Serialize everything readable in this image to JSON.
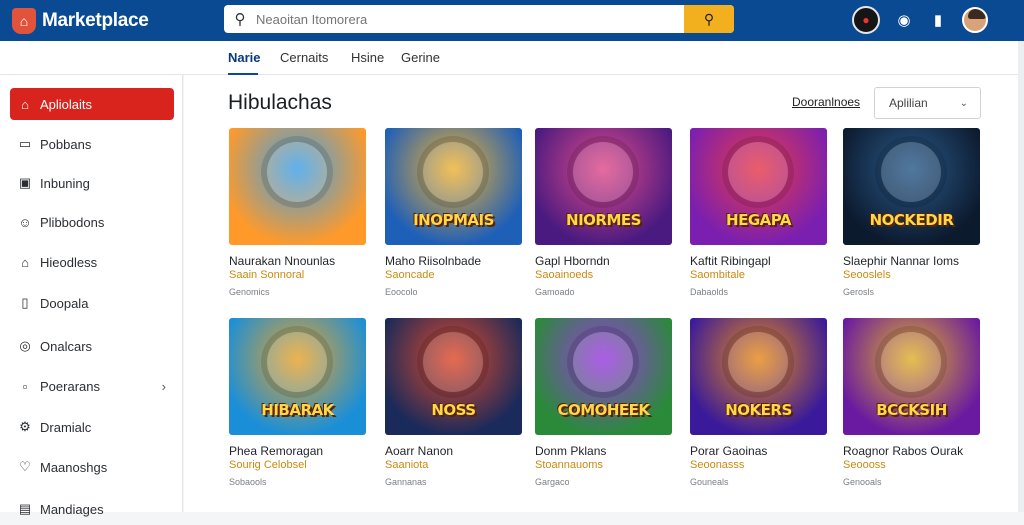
{
  "app": {
    "title": "Marketplace"
  },
  "search": {
    "placeholder": "Neaoitan Itomorera"
  },
  "subnav": {
    "tabs": [
      "Narie",
      "Cernaits",
      "Hsine",
      "Gerine"
    ],
    "active_index": 0
  },
  "sidebar": {
    "items": [
      {
        "label": "Apliolaits",
        "icon": "home-icon",
        "active": true
      },
      {
        "label": "Pobbans",
        "icon": "chat-icon"
      },
      {
        "label": "Inbuning",
        "icon": "inbox-icon"
      },
      {
        "label": "Plibbodons",
        "icon": "users-icon"
      },
      {
        "label": "Hieodless",
        "icon": "building-icon"
      },
      {
        "label": "Doopala",
        "icon": "document-icon"
      },
      {
        "label": "Onalcars",
        "icon": "location-icon"
      },
      {
        "label": "Poerarans",
        "icon": "folder-icon",
        "chevron": true
      },
      {
        "label": "Dramialc",
        "icon": "settings-icon"
      },
      {
        "label": "Maanoshgs",
        "icon": "heart-icon"
      },
      {
        "label": "Mandiages",
        "icon": "bag-icon"
      }
    ]
  },
  "main": {
    "title": "Hibulachas",
    "sort_label": "Dooranlnoes",
    "filter_value": "Aplilian"
  },
  "games": [
    {
      "name": "Naurakan Nnounlas",
      "sub": "Saain Sonnoral",
      "meta": "Genomics",
      "art_title": "",
      "bg1": "#ff9a2a",
      "bg2": "#3da0e8"
    },
    {
      "name": "Maho Riisolnbade",
      "sub": "Saoncade",
      "meta": "Eoocolo",
      "art_title": "INOPMAIS",
      "bg1": "#1e5fb8",
      "bg2": "#f0b232"
    },
    {
      "name": "Gapl Hborndn",
      "sub": "Saoainoeds",
      "meta": "Gamoado",
      "art_title": "NIORMES",
      "bg1": "#4a1a80",
      "bg2": "#e04a8a"
    },
    {
      "name": "Kaftit Ribingapl",
      "sub": "Saombitale",
      "meta": "Dabaolds",
      "art_title": "HEGAPA",
      "bg1": "#7a1fb0",
      "bg2": "#e63a4a"
    },
    {
      "name": "Slaephir Nannar Ioms",
      "sub": "Seooslels",
      "meta": "Gerosls",
      "art_title": "NOCKEDIR",
      "bg1": "#0c1a2e",
      "bg2": "#2a5a8a"
    },
    {
      "name": "Phea Remoragan",
      "sub": "Sourig Celobsel",
      "meta": "Sobaools",
      "art_title": "HIBARAK",
      "bg1": "#1a8fd8",
      "bg2": "#e8a22a"
    },
    {
      "name": "Aoarr Nanon",
      "sub": "Saaniota",
      "meta": "Gannanas",
      "art_title": "NOSS",
      "bg1": "#1a2a5a",
      "bg2": "#e04a2a"
    },
    {
      "name": "Donm Pklans",
      "sub": "Stoannauoms",
      "meta": "Gargaco",
      "art_title": "COMOHEEK",
      "bg1": "#2a8a3a",
      "bg2": "#9a3ae0"
    },
    {
      "name": "Porar Gaoinas",
      "sub": "Seoonasss",
      "meta": "Gouneals",
      "art_title": "NOKERS",
      "bg1": "#3a1a9a",
      "bg2": "#e88a1a"
    },
    {
      "name": "Roagnor Rabos Ourak",
      "sub": "Seoooss",
      "meta": "Genooals",
      "art_title": "BCCKSIH",
      "bg1": "#6a1aa0",
      "bg2": "#e0b02a"
    }
  ]
}
